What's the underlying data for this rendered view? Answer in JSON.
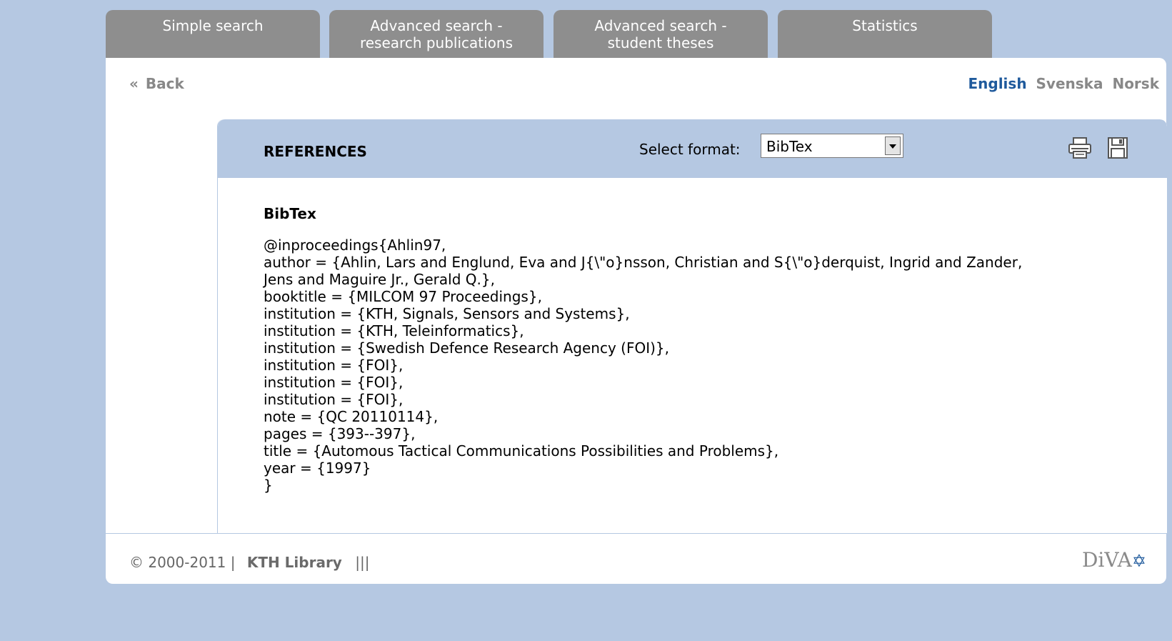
{
  "tabs": [
    {
      "line1": "Simple search",
      "line2": ""
    },
    {
      "line1": "Advanced search -",
      "line2": "research publications"
    },
    {
      "line1": "Advanced search -",
      "line2": "student theses"
    },
    {
      "line1": "Statistics",
      "line2": ""
    }
  ],
  "back": {
    "chevron": "«",
    "label": "Back"
  },
  "languages": {
    "active": "English",
    "others": [
      "Svenska",
      "Norsk"
    ]
  },
  "references": {
    "title": "REFERENCES",
    "format_label": "Select format:",
    "format_value": "BibTex",
    "print_icon": "print-icon",
    "save_icon": "save-icon",
    "format_heading": "BibTex",
    "text": "@inproceedings{Ahlin97,\nauthor = {Ahlin, Lars and Englund, Eva and J{\\\"o}nsson, Christian and S{\\\"o}derquist, Ingrid and Zander,\nJens and Maguire Jr., Gerald Q.},\nbooktitle = {MILCOM 97 Proceedings},\ninstitution = {KTH, Signals, Sensors and Systems},\ninstitution = {KTH, Teleinformatics},\ninstitution = {Swedish Defence Research Agency (FOI)},\ninstitution = {FOI},\ninstitution = {FOI},\ninstitution = {FOI},\nnote = {QC 20110114},\npages = {393--397},\ntitle = {Automous Tactical Communications Possibilities and Problems},\nyear = {1997}\n}"
  },
  "footer": {
    "copyright": "© 2000-2011 |",
    "library": "KTH Library",
    "separator": "|||",
    "logo_text": "DiVA",
    "logo_star": "✡"
  },
  "colors": {
    "background": "#b5c8e2",
    "tab": "#8e8e8e",
    "accent": "#1f5a9c"
  }
}
